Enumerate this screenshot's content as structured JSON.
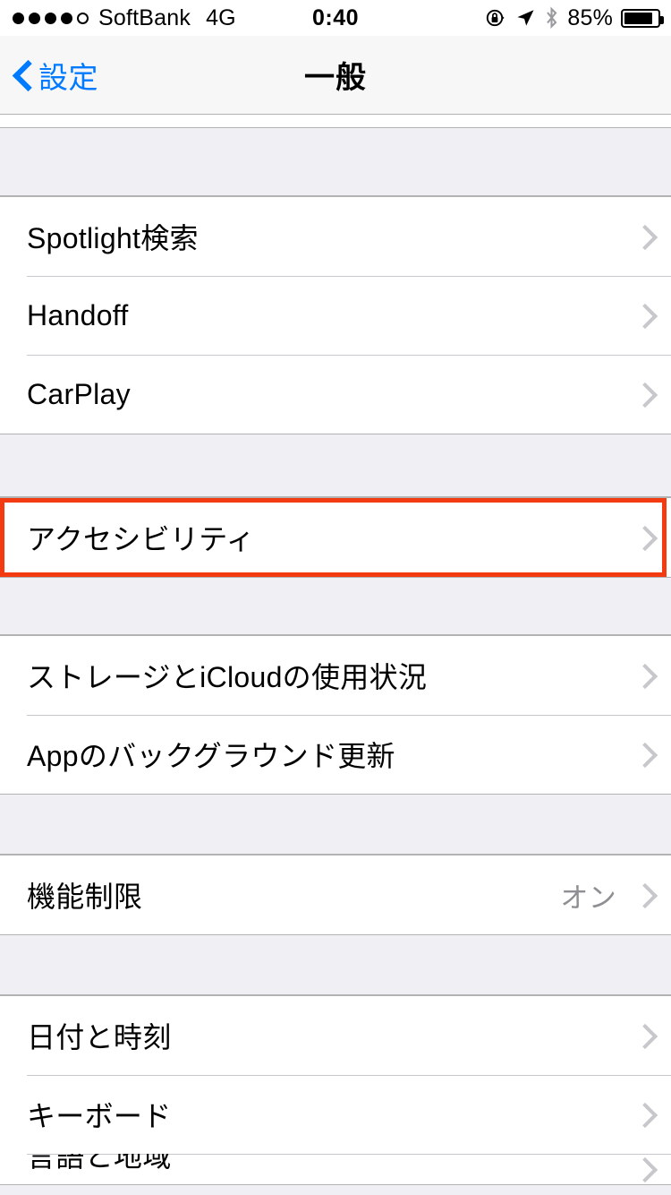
{
  "status_bar": {
    "signal_dots_filled": 4,
    "signal_dots_total": 5,
    "carrier": "SoftBank",
    "network": "4G",
    "time": "0:40",
    "battery_percent": "85%",
    "battery_level": 85,
    "icons": [
      "rotation-lock-icon",
      "location-arrow-icon",
      "bluetooth-icon"
    ]
  },
  "nav_bar": {
    "back_label": "設定",
    "title": "一般"
  },
  "highlight": {
    "color": "#F43A10",
    "target_row": "アクセシビリティ"
  },
  "theme": {
    "tint": "#007AFF",
    "group_background": "#EFEFF4",
    "row_background": "#FFFFFF",
    "separator": "#C8C7CC",
    "chevron": "#C7C7CC",
    "value_text": "#8E8E93"
  },
  "sections": [
    {
      "id": "section-search",
      "rows": [
        {
          "label": "Spotlight検索",
          "value": "",
          "chevron": true
        },
        {
          "label": "Handoff",
          "value": "",
          "chevron": true
        },
        {
          "label": "CarPlay",
          "value": "",
          "chevron": true
        }
      ]
    },
    {
      "id": "section-accessibility",
      "rows": [
        {
          "label": "アクセシビリティ",
          "value": "",
          "chevron": true,
          "highlighted": true
        }
      ]
    },
    {
      "id": "section-storage",
      "rows": [
        {
          "label": "ストレージとiCloudの使用状況",
          "value": "",
          "chevron": true
        },
        {
          "label": "Appのバックグラウンド更新",
          "value": "",
          "chevron": true
        }
      ]
    },
    {
      "id": "section-restrictions",
      "rows": [
        {
          "label": "機能制限",
          "value": "オン",
          "chevron": true
        }
      ]
    },
    {
      "id": "section-datetime",
      "rows": [
        {
          "label": "日付と時刻",
          "value": "",
          "chevron": true
        },
        {
          "label": "キーボード",
          "value": "",
          "chevron": true
        },
        {
          "label": "言語と地域",
          "value": "",
          "chevron": true,
          "partial": true
        }
      ]
    }
  ]
}
